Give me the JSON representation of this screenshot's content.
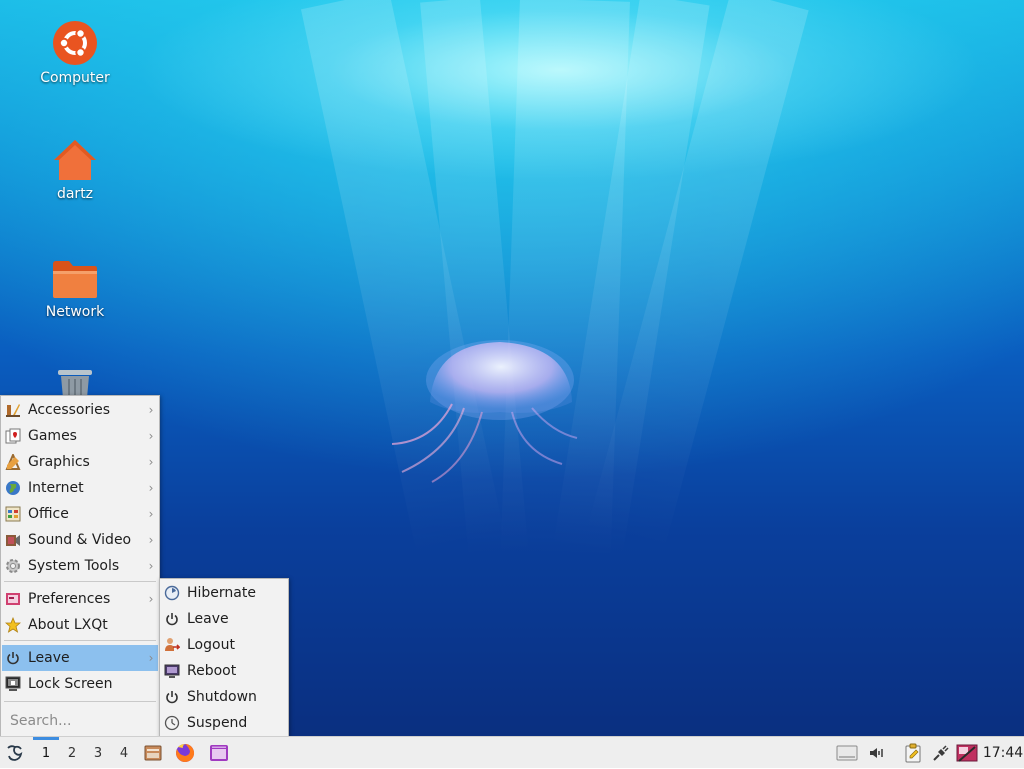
{
  "desktop": {
    "icons": [
      {
        "label": "Computer",
        "icon": "ubuntu-logo-icon"
      },
      {
        "label": "dartz",
        "icon": "home-folder-icon"
      },
      {
        "label": "Network",
        "icon": "folder-icon"
      },
      {
        "label": "",
        "icon": "trash-icon"
      }
    ]
  },
  "menu": {
    "items": [
      {
        "label": "Accessories",
        "icon": "accessories-icon",
        "has_submenu": true
      },
      {
        "label": "Games",
        "icon": "games-icon",
        "has_submenu": true
      },
      {
        "label": "Graphics",
        "icon": "graphics-icon",
        "has_submenu": true
      },
      {
        "label": "Internet",
        "icon": "internet-globe-icon",
        "has_submenu": true
      },
      {
        "label": "Office",
        "icon": "office-icon",
        "has_submenu": true
      },
      {
        "label": "Sound & Video",
        "icon": "sound-video-icon",
        "has_submenu": true
      },
      {
        "label": "System Tools",
        "icon": "system-tools-icon",
        "has_submenu": true
      },
      {
        "label": "Preferences",
        "icon": "preferences-icon",
        "has_submenu": true
      },
      {
        "label": "About LXQt",
        "icon": "star-icon",
        "has_submenu": false
      },
      {
        "label": "Leave",
        "icon": "power-icon",
        "has_submenu": true,
        "highlighted": true
      },
      {
        "label": "Lock Screen",
        "icon": "lock-screen-icon",
        "has_submenu": false
      }
    ],
    "arrow": "›",
    "search_placeholder": "Search..."
  },
  "leave_submenu": {
    "items": [
      {
        "label": "Hibernate",
        "icon": "hibernate-icon"
      },
      {
        "label": "Leave",
        "icon": "power-icon"
      },
      {
        "label": "Logout",
        "icon": "logout-icon"
      },
      {
        "label": "Reboot",
        "icon": "reboot-icon"
      },
      {
        "label": "Shutdown",
        "icon": "power-icon"
      },
      {
        "label": "Suspend",
        "icon": "suspend-icon"
      }
    ]
  },
  "taskbar": {
    "workspaces": [
      "1",
      "2",
      "3",
      "4"
    ],
    "active_workspace": "1",
    "launchers": [
      "file-manager-icon",
      "firefox-icon",
      "terminal-icon"
    ],
    "tray": [
      "removable-drive-icon",
      "volume-icon",
      "clipboard-icon",
      "network-plug-icon",
      "screenshot-icon"
    ],
    "clock": "17:44"
  },
  "colors": {
    "menu_highlight": "#8cc0ee",
    "workspace_indicator": "#3d8de0",
    "ubuntu_orange": "#e95420"
  }
}
